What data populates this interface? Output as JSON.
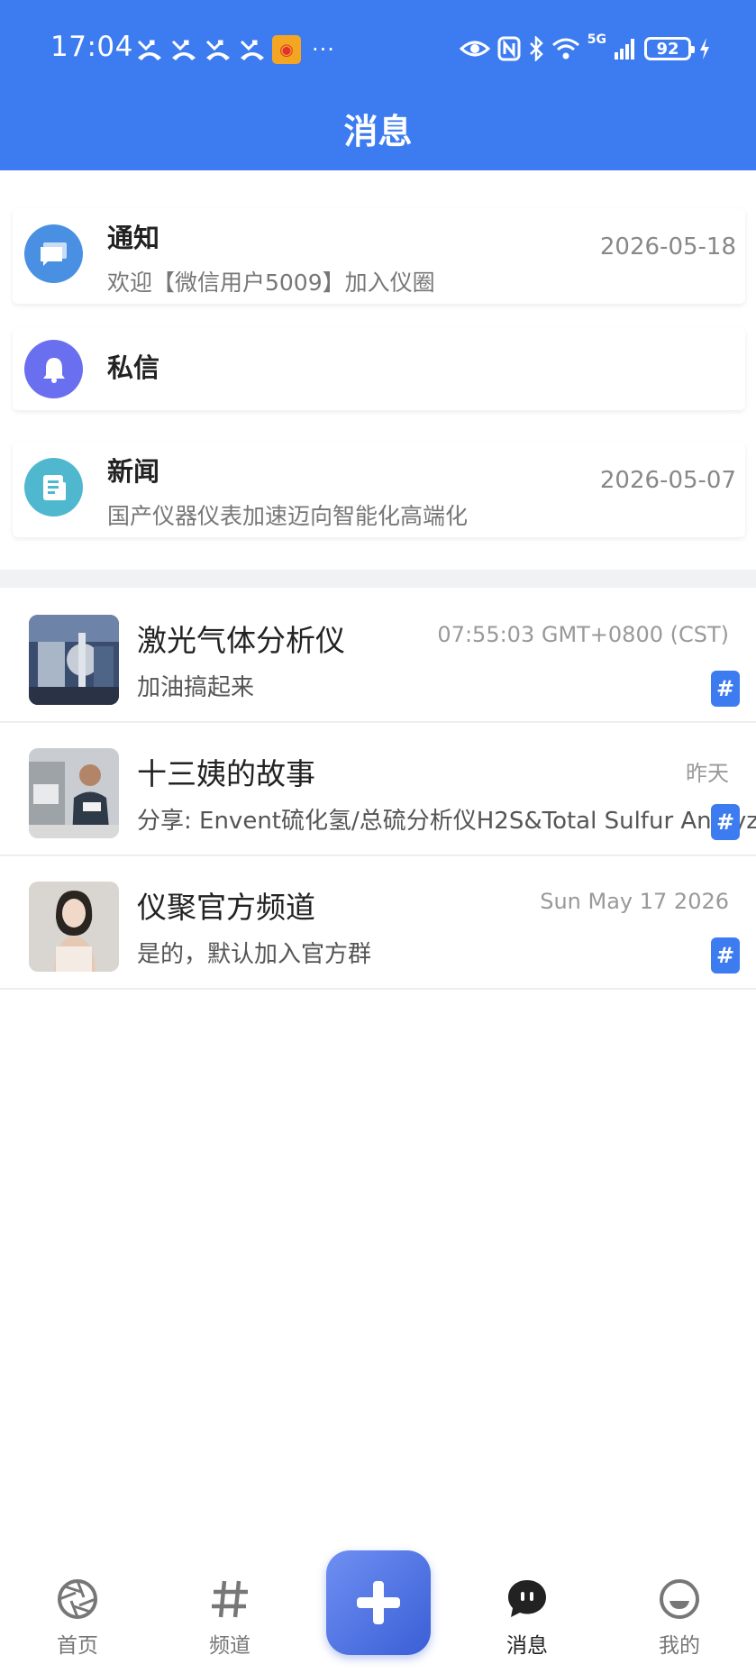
{
  "status_bar": {
    "time": "17:04",
    "more": "···",
    "battery": "92",
    "network": "5G"
  },
  "header": {
    "title": "消息"
  },
  "system_rows": [
    {
      "title": "通知",
      "subtitle": "欢迎【微信用户5009】加入仪圈",
      "date": "2026-05-18",
      "icon": "chat-bubble-icon",
      "color": "#4a90e2"
    },
    {
      "title": "私信",
      "subtitle": "",
      "date": "",
      "icon": "bell-icon",
      "color": "#6a6ff0"
    },
    {
      "title": "新闻",
      "subtitle": "国产仪器仪表加速迈向智能化高端化",
      "date": "2026-05-07",
      "icon": "news-icon",
      "color": "#4fb8cf"
    }
  ],
  "channels": [
    {
      "title": "激光气体分析仪",
      "time": "07:55:03 GMT+0800 (CST)",
      "subtitle": "加油搞起来",
      "badge": "#"
    },
    {
      "title": "十三姨的故事",
      "time": "昨天",
      "subtitle": "分享: Envent硫化氢/总硫分析仪H2S&Total Sulfur Analyz",
      "badge": "#"
    },
    {
      "title": "仪聚官方频道",
      "time": "Sun May 17 2026",
      "subtitle": "是的，默认加入官方群",
      "badge": "#"
    }
  ],
  "bottom_nav": {
    "home": "首页",
    "channels": "频道",
    "messages": "消息",
    "mine": "我的",
    "active": "messages"
  },
  "colors": {
    "brand": "#3d7cf0",
    "badge": "#3d7cf0"
  }
}
